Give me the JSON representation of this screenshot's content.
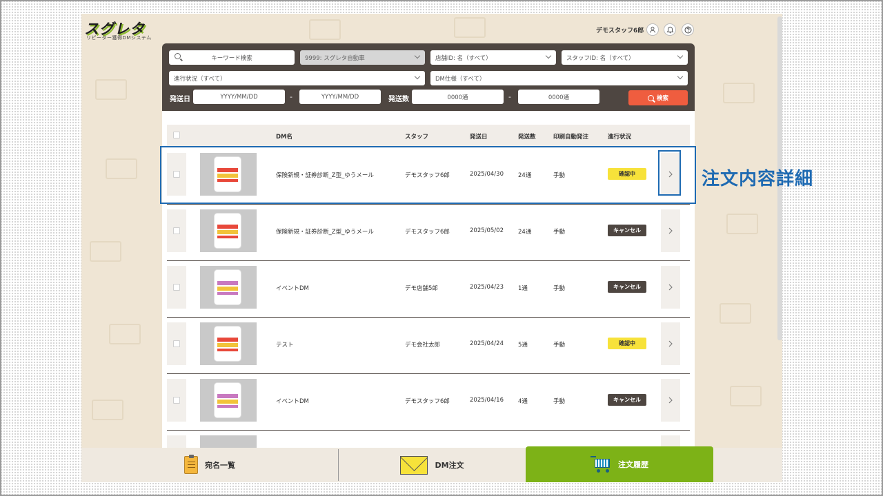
{
  "header": {
    "logo_main": "スグレタ",
    "logo_sub": "リピーター獲得DMシステム",
    "user_name": "デモスタッフ6郎"
  },
  "filters": {
    "keyword_button": "キーワード検索",
    "company_select": "9999: スグレタ自動車",
    "store_select": "店舗ID: 名（すべて）",
    "staff_select": "スタッフID: 名（すべて）",
    "progress_select": "進行状況（すべて）",
    "dm_spec_select": "DM仕様（すべて）",
    "send_date_label": "発送日",
    "date_from": "YYYY/MM/DD",
    "date_sep": "-",
    "date_to": "YYYY/MM/DD",
    "send_count_label": "発送数",
    "count_from": "0000通",
    "count_sep": "-",
    "count_to": "0000通",
    "search_button": "検索"
  },
  "table": {
    "columns": {
      "dm_name": "DM名",
      "staff": "スタッフ",
      "send_date": "発送日",
      "send_count": "発送数",
      "auto_print": "印刷自動発注",
      "progress": "進行状況"
    },
    "rows": [
      {
        "dm_name": "保険新規・証券診断_Z型_ゆうメール",
        "staff": "デモスタッフ6郎",
        "send_date": "2025/04/30",
        "send_count": "24通",
        "auto_print": "手動",
        "status": "確認中",
        "status_type": "confirm"
      },
      {
        "dm_name": "保険新規・証券診断_Z型_ゆうメール",
        "staff": "デモスタッフ6郎",
        "send_date": "2025/05/02",
        "send_count": "24通",
        "auto_print": "手動",
        "status": "キャンセル",
        "status_type": "cancel"
      },
      {
        "dm_name": "イベントDM",
        "staff": "デモ店舗5郎",
        "send_date": "2025/04/23",
        "send_count": "1通",
        "auto_print": "手動",
        "status": "キャンセル",
        "status_type": "cancel"
      },
      {
        "dm_name": "テスト",
        "staff": "デモ会社太郎",
        "send_date": "2025/04/24",
        "send_count": "5通",
        "auto_print": "手動",
        "status": "確認中",
        "status_type": "confirm"
      },
      {
        "dm_name": "イベントDM",
        "staff": "デモスタッフ6郎",
        "send_date": "2025/04/16",
        "send_count": "4通",
        "auto_print": "手動",
        "status": "キャンセル",
        "status_type": "cancel"
      }
    ]
  },
  "callout": {
    "text": "注文内容詳細"
  },
  "footer": {
    "nav": [
      {
        "label": "宛名一覧",
        "icon": "clipboard-icon"
      },
      {
        "label": "DM注文",
        "icon": "envelope-icon"
      },
      {
        "label": "注文履歴",
        "icon": "cart-icon"
      }
    ]
  },
  "colors": {
    "panel": "#4e4641",
    "search": "#ef5d3f",
    "confirm_badge": "#f7e23a",
    "cancel_badge": "#4e4641",
    "active_nav": "#7db217",
    "callout": "#1e6ab2",
    "app_bg": "#efe5d4"
  }
}
